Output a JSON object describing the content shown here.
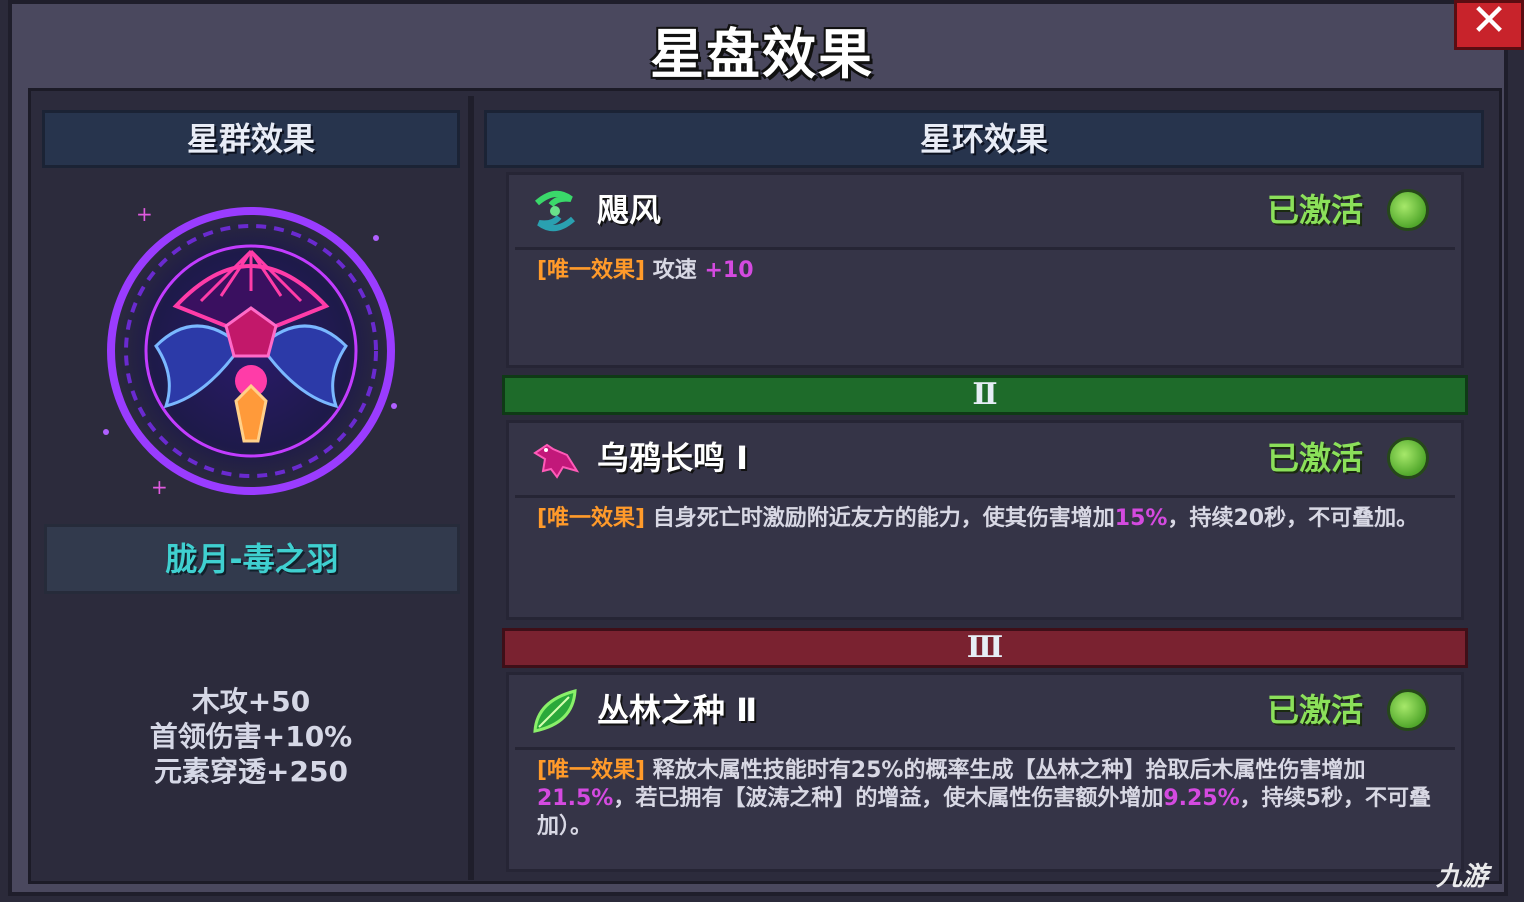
{
  "window": {
    "title": "星盘效果",
    "close_label": "✕"
  },
  "left_panel": {
    "header": "星群效果",
    "emblem_icon": "crow-constellation-icon",
    "name": "胧月-毒之羽",
    "stats": [
      "木攻+50",
      "首领伤害+10%",
      "元素穿透+250"
    ]
  },
  "right_panel": {
    "header": "星环效果",
    "effects": [
      {
        "icon": "wind-swirl-icon",
        "name": "飓风",
        "status": "已激活",
        "tag": "[唯一效果]",
        "desc_parts": [
          " 攻速 ",
          "+10"
        ]
      },
      {
        "icon": "crow-icon",
        "name": "乌鸦长鸣 Ⅰ",
        "status": "已激活",
        "tag": "[唯一效果]",
        "desc_parts": [
          " 自身死亡时激励附近友方的能力，使其伤害增加",
          "15%",
          "，持续20秒，不可叠加。"
        ]
      },
      {
        "icon": "green-seed-icon",
        "name": "丛林之种 Ⅱ",
        "status": "已激活",
        "tag": "[唯一效果]",
        "desc_parts": [
          " 释放木属性技能时有25%的概率生成【丛林之种】拾取后木属性伤害增加",
          "21.5%",
          "，若已拥有【波涛之种】的增益，使木属性伤害额外增加",
          "9.25%",
          "，持续5秒，不可叠加）。"
        ]
      }
    ],
    "tiers": [
      "Ⅱ",
      "Ⅲ"
    ]
  },
  "watermark": "九游",
  "colors": {
    "status_active": "#8be05a",
    "tag": "#ff9a2a",
    "highlight": "#d44ae0",
    "name_plate": "#3fd0d0"
  }
}
